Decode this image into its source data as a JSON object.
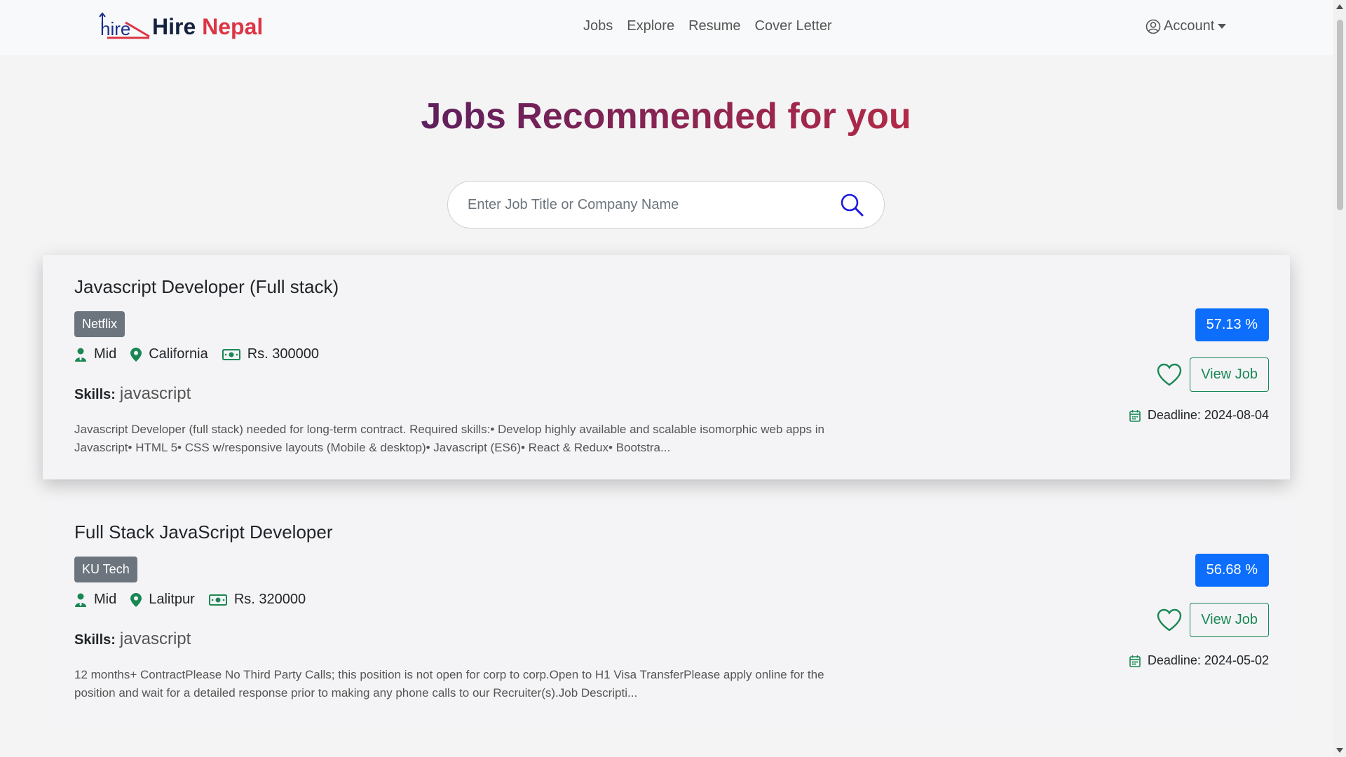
{
  "brand": {
    "hire": "Hire",
    "nepal": "Nepal"
  },
  "nav": {
    "items": [
      "Jobs",
      "Explore",
      "Resume",
      "Cover Letter"
    ],
    "account": "Account"
  },
  "page": {
    "title": "Jobs Recommended for you"
  },
  "search": {
    "placeholder": "Enter Job Title or Company Name"
  },
  "skills_label": "Skills:",
  "view_job_label": "View Job",
  "deadline_label": "Deadline:",
  "jobs": [
    {
      "title": "Javascript Developer (Full stack)",
      "company": "Netflix",
      "level": "Mid",
      "location": "California",
      "salary": "Rs. 300000",
      "skills": "javascript",
      "description": "Javascript Developer (full stack) needed for long-term contract. Required skills:• Develop highly available and scalable isomorphic web apps in Javascript• HTML 5• CSS w/responsive layouts (Mobile & desktop)• Javascript (ES6)• React & Redux• Bootstra...",
      "match": "57.13 %",
      "deadline": "2024-08-04"
    },
    {
      "title": "Full Stack JavaScript Developer",
      "company": "KU Tech",
      "level": "Mid",
      "location": "Lalitpur",
      "salary": "Rs. 320000",
      "skills": "javascript",
      "description": "12 months+ ContractPlease No Third Party Calls; this position is not open for corp to corp.Open to H1 Visa TransferPlease apply online for the position and wait for a detailed response prior to making any phone calls to our Recruiter(s).Job Descripti...",
      "match": "56.68 %",
      "deadline": "2024-05-02"
    }
  ]
}
